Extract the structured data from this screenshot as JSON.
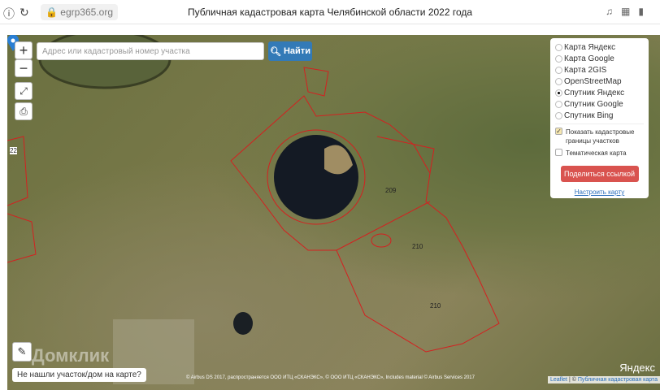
{
  "browser": {
    "url": "egrp365.org",
    "title": "Публичная кадастровая карта Челябинской области 2022 года"
  },
  "search": {
    "placeholder": "Адрес или кадастровый номер участка",
    "button": "Найти"
  },
  "zoom": {
    "in": "+",
    "out": "−"
  },
  "layers": {
    "options": [
      "Карта Яндекс",
      "Карта Google",
      "Карта 2GIS",
      "OpenStreetMap",
      "Спутник Яндекс",
      "Спутник Google",
      "Спутник Bing"
    ],
    "selected": "Спутник Яндекс"
  },
  "checks": {
    "cadastral": "Показать кадастровые границы участков",
    "cadastral_checked": true,
    "thematic": "Тематическая карта",
    "thematic_checked": false
  },
  "share_button": "Поделиться ссылкой",
  "setup_link": "Настроить карту",
  "not_found": "Не нашли участок/дом на карте?",
  "parcels": [
    "209",
    "210",
    "210",
    "22"
  ],
  "watermark": "Домклик",
  "yandex_logo": "Яндекс",
  "attribution": "© Airbus DS 2017, распространяется ООО ИТЦ «СКАНЭКС», © ООО ИТЦ «СКАНЭКС», Includes material © Airbus Services 2017",
  "attribution_links": {
    "leaflet": "Leaflet",
    "sep": " | © ",
    "pkk": "Публичная кадастровая карта"
  },
  "colors": {
    "accent": "#337ab7",
    "share": "#d9534f",
    "parcel": "#d42020"
  }
}
